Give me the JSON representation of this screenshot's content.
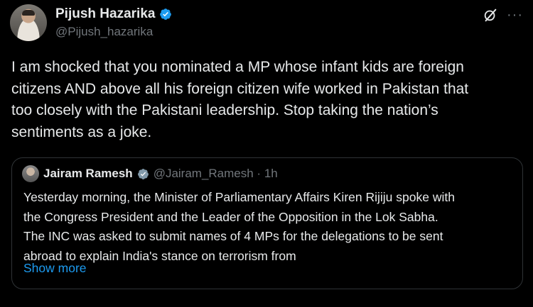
{
  "author": {
    "display_name": "Pijush Hazarika",
    "handle": "@Pijush_hazarika",
    "verified_color": "#1d9bf0",
    "avatar_icon": "user-avatar"
  },
  "actions": {
    "grok_icon": "grok-icon",
    "more_label": "···"
  },
  "tweet": {
    "text": "I am shocked that you nominated a MP whose infant kids are foreign\ncitizens AND above all his foreign citizen wife  worked in Pakistan that\ntoo closely with the Pakistani leadership. Stop  taking the nation’s\nsentiments as a joke."
  },
  "quote": {
    "display_name": "Jairam Ramesh",
    "handle_time": "@Jairam_Ramesh · 1h",
    "text": "Yesterday morning, the Minister of Parliamentary Affairs Kiren Rijiju spoke with\nthe Congress President and the Leader of the Opposition in the Lok Sabha.\nThe INC was asked to submit names of 4 MPs for the delegations to be sent\nabroad to explain India's stance on terrorism from",
    "show_more": "Show more",
    "link_color": "#1d9bf0"
  }
}
